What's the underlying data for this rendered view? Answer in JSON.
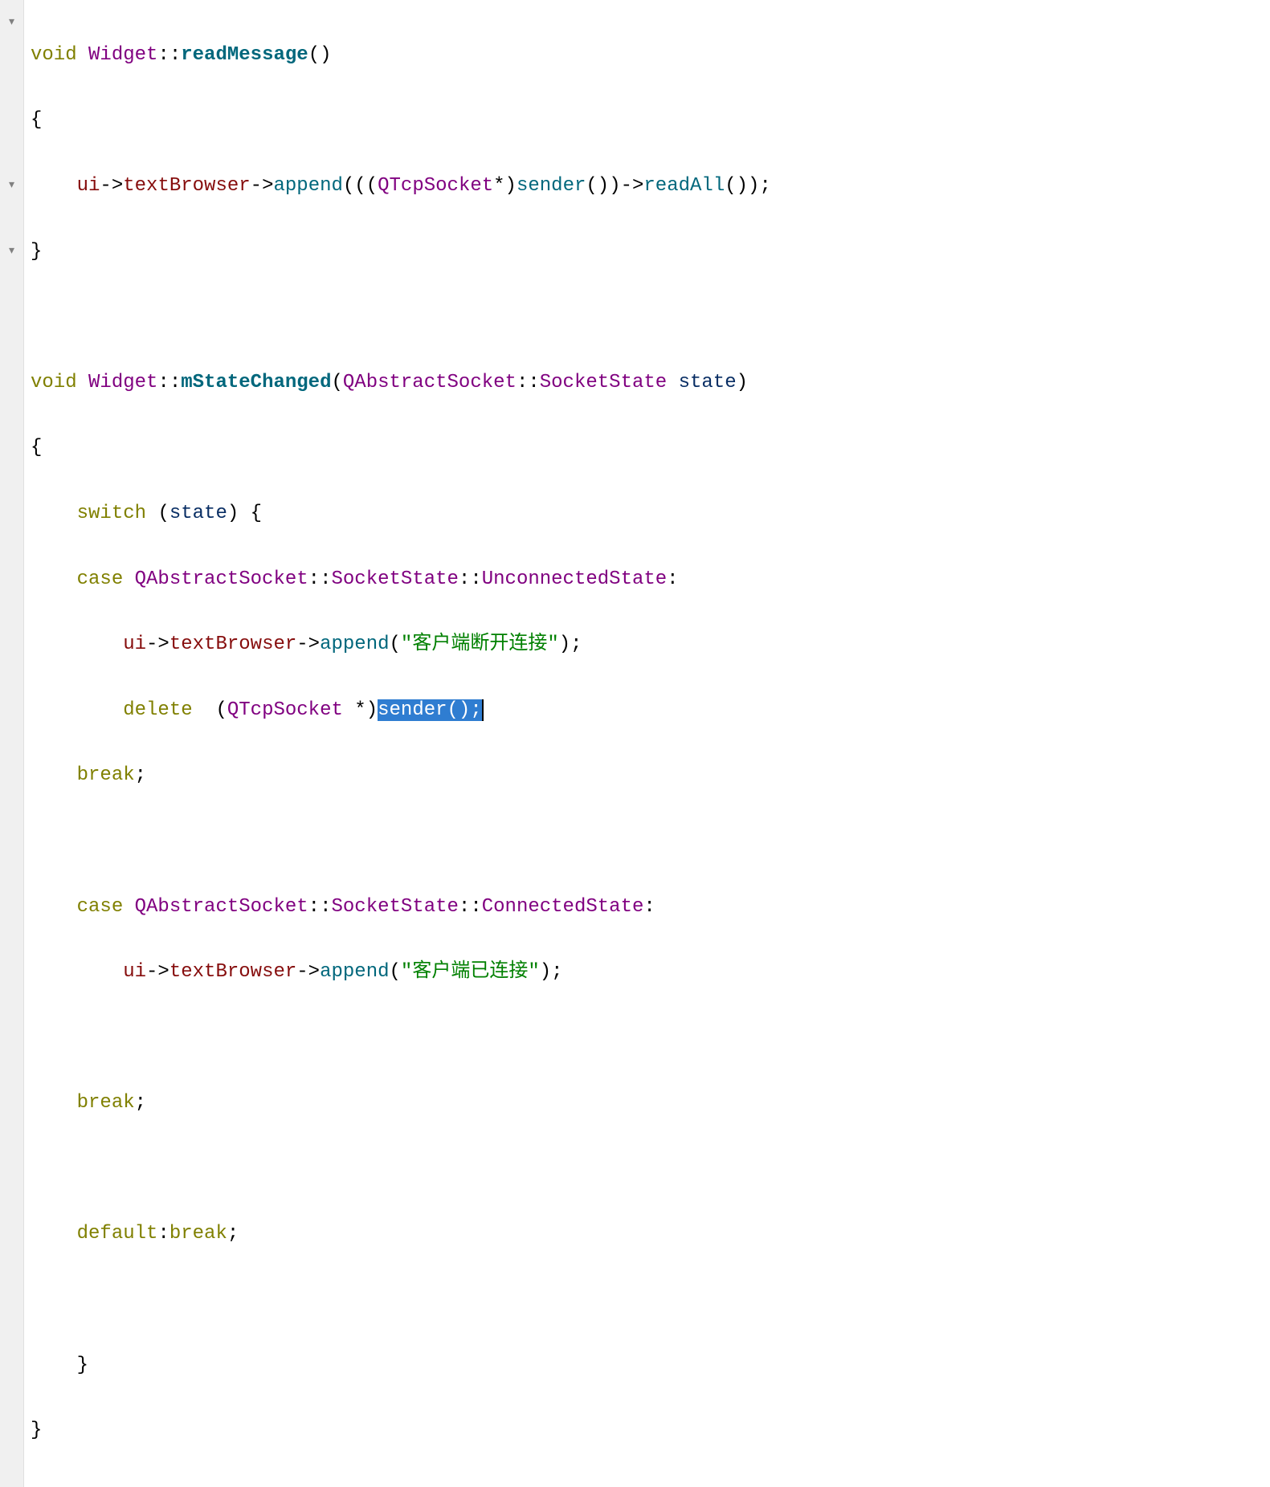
{
  "colors": {
    "keyword": "#808000",
    "type": "#800080",
    "function": "#00677c",
    "member": "#860d0d",
    "string": "#008000",
    "selection_bg": "#2f7dd1",
    "gutter_bg": "#f0f0f0"
  },
  "fold_markers": [
    "▾",
    "▾",
    "▾"
  ],
  "code": {
    "func1": {
      "ret": "void",
      "class": "Widget",
      "name": "readMessage",
      "body_ui": "ui",
      "body_tb": "textBrowser",
      "body_append": "append",
      "body_cast": "QTcpSocket",
      "body_sender": "sender",
      "body_readall": "readAll"
    },
    "func2": {
      "ret": "void",
      "class": "Widget",
      "name": "mStateChanged",
      "param_type": "QAbstractSocket",
      "param_sub": "SocketState",
      "param_name": "state",
      "switch_kw": "switch",
      "case_kw": "case",
      "break_kw": "break",
      "default_kw": "default",
      "delete_kw": "delete",
      "enum_ns": "QAbstractSocket",
      "enum_sub": "SocketState",
      "case1_enum": "UnconnectedState",
      "case1_ui": "ui",
      "case1_tb": "textBrowser",
      "case1_append": "append",
      "case1_str": "\"客户端断开连接\"",
      "case1_cast": "QTcpSocket",
      "case1_sender_sel": "sender();",
      "case2_enum": "ConnectedState",
      "case2_ui": "ui",
      "case2_tb": "textBrowser",
      "case2_append": "append",
      "case2_str": "\"客户端已连接\""
    }
  }
}
